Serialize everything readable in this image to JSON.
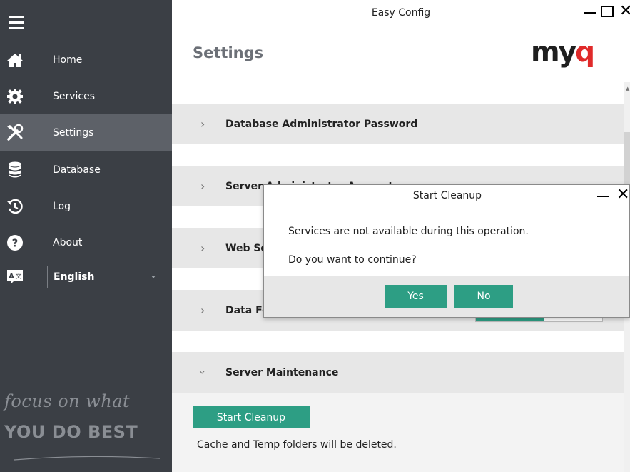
{
  "window": {
    "title": "Easy Config"
  },
  "sidebar": {
    "items": [
      {
        "label": "Home",
        "icon": "home-icon"
      },
      {
        "label": "Services",
        "icon": "gear-icon"
      },
      {
        "label": "Settings",
        "icon": "tools-icon",
        "active": true
      },
      {
        "label": "Database",
        "icon": "database-icon"
      },
      {
        "label": "Log",
        "icon": "history-icon"
      },
      {
        "label": "About",
        "icon": "help-icon"
      }
    ],
    "language": {
      "selected": "English",
      "icon": "translate-icon"
    },
    "slogan": {
      "line1": "focus on what",
      "line2": "YOU DO BEST"
    }
  },
  "page": {
    "title": "Settings",
    "logo": "myq"
  },
  "sections": [
    {
      "title": "Database Administrator Password",
      "expanded": false
    },
    {
      "title": "Server Administrator Account",
      "expanded": false
    },
    {
      "title": "Web Se",
      "expanded": false
    },
    {
      "title": "Data Fo",
      "expanded": false
    },
    {
      "title": "Server Maintenance",
      "expanded": true
    }
  ],
  "maintenance": {
    "button_label": "Start Cleanup",
    "note": "Cache and Temp folders will be deleted."
  },
  "dialog": {
    "title": "Start Cleanup",
    "message": "Services are not available during this operation.",
    "question": "Do you want to continue?",
    "yes_label": "Yes",
    "no_label": "No"
  },
  "colors": {
    "sidebar": "#3b3f45",
    "sidebar_active": "#5d6168",
    "accent": "#2d9e84",
    "section_bg": "#e7e7e7",
    "logo_q": "#e02a2a"
  }
}
